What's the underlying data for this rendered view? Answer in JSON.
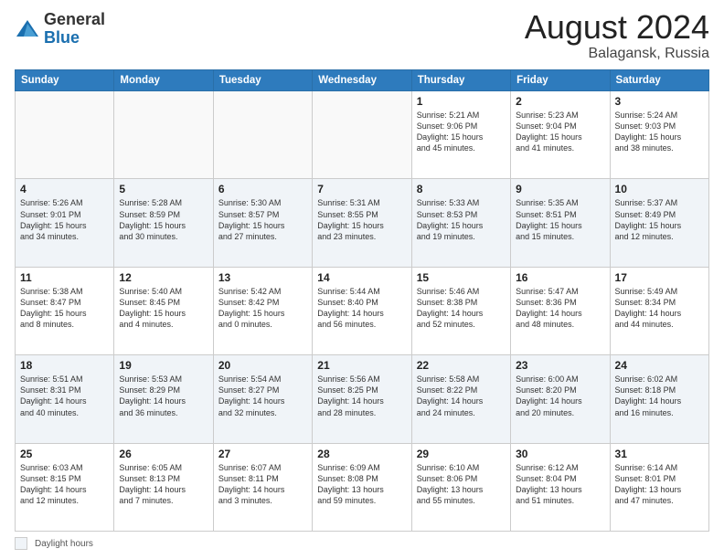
{
  "logo": {
    "general": "General",
    "blue": "Blue"
  },
  "header": {
    "month": "August 2024",
    "location": "Balagansk, Russia"
  },
  "days_of_week": [
    "Sunday",
    "Monday",
    "Tuesday",
    "Wednesday",
    "Thursday",
    "Friday",
    "Saturday"
  ],
  "weeks": [
    [
      {
        "day": "",
        "info": ""
      },
      {
        "day": "",
        "info": ""
      },
      {
        "day": "",
        "info": ""
      },
      {
        "day": "",
        "info": ""
      },
      {
        "day": "1",
        "info": "Sunrise: 5:21 AM\nSunset: 9:06 PM\nDaylight: 15 hours\nand 45 minutes."
      },
      {
        "day": "2",
        "info": "Sunrise: 5:23 AM\nSunset: 9:04 PM\nDaylight: 15 hours\nand 41 minutes."
      },
      {
        "day": "3",
        "info": "Sunrise: 5:24 AM\nSunset: 9:03 PM\nDaylight: 15 hours\nand 38 minutes."
      }
    ],
    [
      {
        "day": "4",
        "info": "Sunrise: 5:26 AM\nSunset: 9:01 PM\nDaylight: 15 hours\nand 34 minutes."
      },
      {
        "day": "5",
        "info": "Sunrise: 5:28 AM\nSunset: 8:59 PM\nDaylight: 15 hours\nand 30 minutes."
      },
      {
        "day": "6",
        "info": "Sunrise: 5:30 AM\nSunset: 8:57 PM\nDaylight: 15 hours\nand 27 minutes."
      },
      {
        "day": "7",
        "info": "Sunrise: 5:31 AM\nSunset: 8:55 PM\nDaylight: 15 hours\nand 23 minutes."
      },
      {
        "day": "8",
        "info": "Sunrise: 5:33 AM\nSunset: 8:53 PM\nDaylight: 15 hours\nand 19 minutes."
      },
      {
        "day": "9",
        "info": "Sunrise: 5:35 AM\nSunset: 8:51 PM\nDaylight: 15 hours\nand 15 minutes."
      },
      {
        "day": "10",
        "info": "Sunrise: 5:37 AM\nSunset: 8:49 PM\nDaylight: 15 hours\nand 12 minutes."
      }
    ],
    [
      {
        "day": "11",
        "info": "Sunrise: 5:38 AM\nSunset: 8:47 PM\nDaylight: 15 hours\nand 8 minutes."
      },
      {
        "day": "12",
        "info": "Sunrise: 5:40 AM\nSunset: 8:45 PM\nDaylight: 15 hours\nand 4 minutes."
      },
      {
        "day": "13",
        "info": "Sunrise: 5:42 AM\nSunset: 8:42 PM\nDaylight: 15 hours\nand 0 minutes."
      },
      {
        "day": "14",
        "info": "Sunrise: 5:44 AM\nSunset: 8:40 PM\nDaylight: 14 hours\nand 56 minutes."
      },
      {
        "day": "15",
        "info": "Sunrise: 5:46 AM\nSunset: 8:38 PM\nDaylight: 14 hours\nand 52 minutes."
      },
      {
        "day": "16",
        "info": "Sunrise: 5:47 AM\nSunset: 8:36 PM\nDaylight: 14 hours\nand 48 minutes."
      },
      {
        "day": "17",
        "info": "Sunrise: 5:49 AM\nSunset: 8:34 PM\nDaylight: 14 hours\nand 44 minutes."
      }
    ],
    [
      {
        "day": "18",
        "info": "Sunrise: 5:51 AM\nSunset: 8:31 PM\nDaylight: 14 hours\nand 40 minutes."
      },
      {
        "day": "19",
        "info": "Sunrise: 5:53 AM\nSunset: 8:29 PM\nDaylight: 14 hours\nand 36 minutes."
      },
      {
        "day": "20",
        "info": "Sunrise: 5:54 AM\nSunset: 8:27 PM\nDaylight: 14 hours\nand 32 minutes."
      },
      {
        "day": "21",
        "info": "Sunrise: 5:56 AM\nSunset: 8:25 PM\nDaylight: 14 hours\nand 28 minutes."
      },
      {
        "day": "22",
        "info": "Sunrise: 5:58 AM\nSunset: 8:22 PM\nDaylight: 14 hours\nand 24 minutes."
      },
      {
        "day": "23",
        "info": "Sunrise: 6:00 AM\nSunset: 8:20 PM\nDaylight: 14 hours\nand 20 minutes."
      },
      {
        "day": "24",
        "info": "Sunrise: 6:02 AM\nSunset: 8:18 PM\nDaylight: 14 hours\nand 16 minutes."
      }
    ],
    [
      {
        "day": "25",
        "info": "Sunrise: 6:03 AM\nSunset: 8:15 PM\nDaylight: 14 hours\nand 12 minutes."
      },
      {
        "day": "26",
        "info": "Sunrise: 6:05 AM\nSunset: 8:13 PM\nDaylight: 14 hours\nand 7 minutes."
      },
      {
        "day": "27",
        "info": "Sunrise: 6:07 AM\nSunset: 8:11 PM\nDaylight: 14 hours\nand 3 minutes."
      },
      {
        "day": "28",
        "info": "Sunrise: 6:09 AM\nSunset: 8:08 PM\nDaylight: 13 hours\nand 59 minutes."
      },
      {
        "day": "29",
        "info": "Sunrise: 6:10 AM\nSunset: 8:06 PM\nDaylight: 13 hours\nand 55 minutes."
      },
      {
        "day": "30",
        "info": "Sunrise: 6:12 AM\nSunset: 8:04 PM\nDaylight: 13 hours\nand 51 minutes."
      },
      {
        "day": "31",
        "info": "Sunrise: 6:14 AM\nSunset: 8:01 PM\nDaylight: 13 hours\nand 47 minutes."
      }
    ]
  ],
  "footer": {
    "daylight_label": "Daylight hours"
  }
}
